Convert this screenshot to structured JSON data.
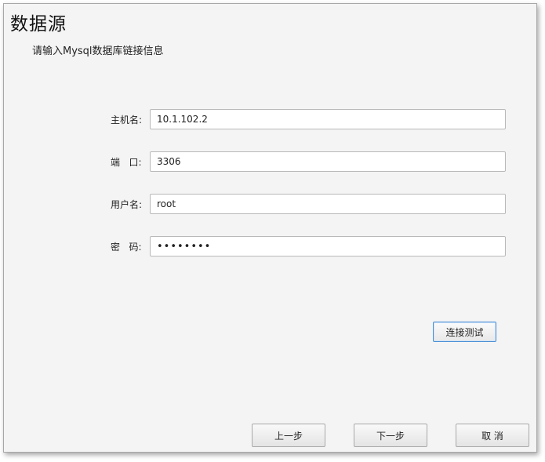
{
  "window": {
    "title": "数据源",
    "subtitle": "请输入Mysql数据库链接信息"
  },
  "form": {
    "host": {
      "label": "主机名:",
      "value": "10.1.102.2"
    },
    "port": {
      "label": "端   口:",
      "value": "3306"
    },
    "user": {
      "label": "用户名:",
      "value": "root"
    },
    "password": {
      "label": "密   码:",
      "value": "••••••••"
    }
  },
  "buttons": {
    "test_connection": "连接测试",
    "prev": "上一步",
    "next": "下一步",
    "cancel": "取 消"
  },
  "colors": {
    "accent_border": "#4a8fd6"
  }
}
